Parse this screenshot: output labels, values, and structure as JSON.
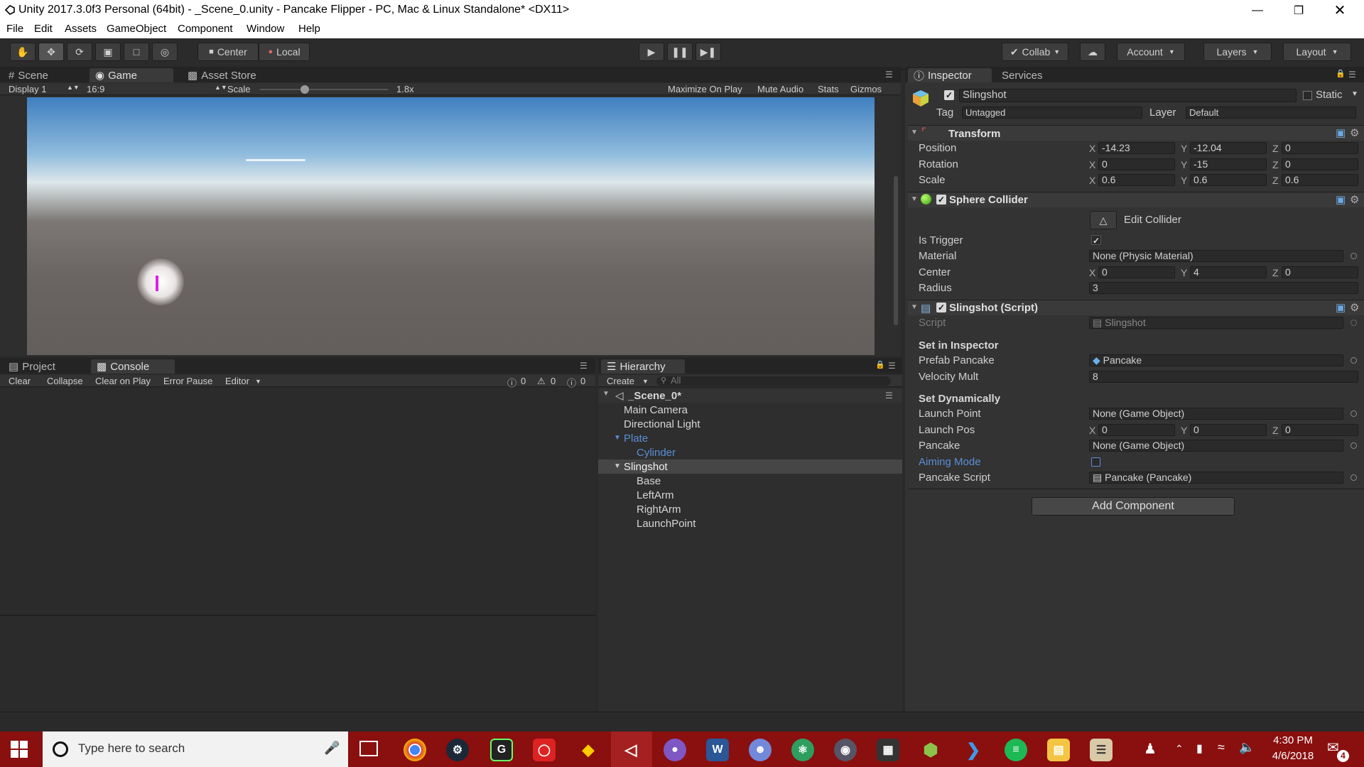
{
  "window": {
    "title": "Unity 2017.3.0f3 Personal (64bit) - _Scene_0.unity - Pancake Flipper - PC, Mac & Linux Standalone* <DX11>"
  },
  "menu": [
    "File",
    "Edit",
    "Assets",
    "GameObject",
    "Component",
    "Window",
    "Help"
  ],
  "toolbar": {
    "pivot_center": "Center",
    "pivot_local": "Local",
    "collab": "Collab",
    "account": "Account",
    "layers": "Layers",
    "layout": "Layout"
  },
  "scene_tabs": {
    "scene": "Scene",
    "game": "Game",
    "asset_store": "Asset Store"
  },
  "game_bar": {
    "display": "Display 1",
    "aspect": "16:9",
    "scale_label": "Scale",
    "scale_value": "1.8x",
    "scale_level": 0.35,
    "maximize": "Maximize On Play",
    "mute": "Mute Audio",
    "stats": "Stats",
    "gizmos": "Gizmos"
  },
  "bottom_tabs": {
    "project": "Project",
    "console": "Console"
  },
  "console_bar": {
    "clear": "Clear",
    "collapse": "Collapse",
    "clear_on_play": "Clear on Play",
    "error_pause": "Error Pause",
    "editor": "Editor",
    "count_info": "0",
    "count_warn": "0",
    "count_error": "0"
  },
  "hierarchy": {
    "tab": "Hierarchy",
    "create": "Create",
    "search_placeholder": "All",
    "scene": "_Scene_0*",
    "items": [
      {
        "label": "Main Camera"
      },
      {
        "label": "Directional Light"
      },
      {
        "label": "Plate"
      },
      {
        "label": "Cylinder"
      },
      {
        "label": "Slingshot"
      },
      {
        "label": "Base"
      },
      {
        "label": "LeftArm"
      },
      {
        "label": "RightArm"
      },
      {
        "label": "LaunchPoint"
      }
    ]
  },
  "inspector": {
    "tab": "Inspector",
    "services_tab": "Services",
    "object_name": "Slingshot",
    "static_label": "Static",
    "tag_label": "Tag",
    "tag_value": "Untagged",
    "layer_label": "Layer",
    "layer_value": "Default",
    "transform": {
      "title": "Transform",
      "position_label": "Position",
      "rotation_label": "Rotation",
      "scale_label": "Scale",
      "px": "-14.23",
      "py": "-12.04",
      "pz": "0",
      "rx": "0",
      "ry": "-15",
      "rz": "0",
      "sx": "0.6",
      "sy": "0.6",
      "sz": "0.6"
    },
    "sphere_collider": {
      "title": "Sphere Collider",
      "edit_collider": "Edit Collider",
      "is_trigger_label": "Is Trigger",
      "material_label": "Material",
      "material_value": "None (Physic Material)",
      "center_label": "Center",
      "cx": "0",
      "cy": "4",
      "cz": "0",
      "radius_label": "Radius",
      "radius_value": "3"
    },
    "script": {
      "title": "Slingshot (Script)",
      "script_label": "Script",
      "script_value": "Slingshot",
      "set_in_inspector": "Set in Inspector",
      "prefab_label": "Prefab Pancake",
      "prefab_value": "Pancake",
      "velocity_label": "Velocity Mult",
      "velocity_value": "8",
      "set_dynamically": "Set Dynamically",
      "launch_point_label": "Launch Point",
      "launch_point_value": "None (Game Object)",
      "launch_pos_label": "Launch Pos",
      "lx": "0",
      "ly": "0",
      "lz": "0",
      "pancake_label": "Pancake",
      "pancake_value": "None (Game Object)",
      "aiming_label": "Aiming Mode",
      "pancake_script_label": "Pancake Script",
      "pancake_script_value": "Pancake (Pancake)"
    },
    "add_component": "Add Component",
    "axis_x": "X",
    "axis_y": "Y",
    "axis_z": "Z"
  },
  "taskbar": {
    "search_placeholder": "Type here to search",
    "time": "4:30 PM",
    "date": "4/6/2018",
    "notification_count": "4",
    "accent": "#8a0f0f"
  }
}
